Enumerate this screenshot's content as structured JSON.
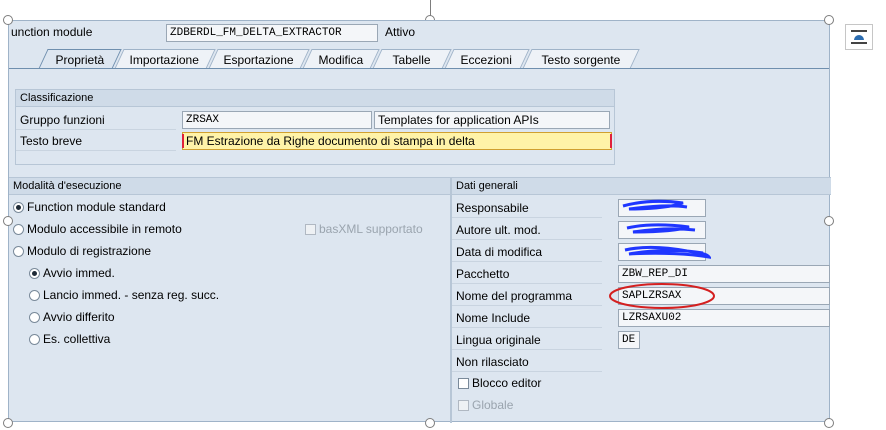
{
  "header": {
    "object_type_label": "unction module",
    "object_name": "ZDBERDL_FM_DELTA_EXTRACTOR",
    "status": "Attivo"
  },
  "tabs": [
    {
      "label": "Proprietà"
    },
    {
      "label": "Importazione"
    },
    {
      "label": "Esportazione"
    },
    {
      "label": "Modifica"
    },
    {
      "label": "Tabelle"
    },
    {
      "label": "Eccezioni"
    },
    {
      "label": "Testo sorgente"
    }
  ],
  "classification": {
    "title": "Classificazione",
    "function_group_label": "Gruppo funzioni",
    "function_group_value": "ZRSAX",
    "function_group_desc": "Templates for application APIs",
    "short_text_label": "Testo breve",
    "short_text_value": "FM Estrazione da Righe documento di stampa in delta"
  },
  "processing_type": {
    "title": "Modalità d'esecuzione",
    "options": [
      {
        "label": "Function module standard",
        "selected": true
      },
      {
        "label": "Modulo accessibile in remoto",
        "selected": false
      },
      {
        "label": "Modulo di registrazione",
        "selected": false
      }
    ],
    "basxml_label": "basXML supportato",
    "update_options": [
      {
        "label": "Avvio immed.",
        "selected": true
      },
      {
        "label": "Lancio immed. - senza reg. succ.",
        "selected": false
      },
      {
        "label": "Avvio differito",
        "selected": false
      },
      {
        "label": "Es. collettiva",
        "selected": false
      }
    ]
  },
  "general_data": {
    "title": "Dati generali",
    "rows": [
      {
        "label": "Responsabile",
        "value": ""
      },
      {
        "label": "Autore ult. mod.",
        "value": ""
      },
      {
        "label": "Data di modifica",
        "value": ""
      },
      {
        "label": "Pacchetto",
        "value": "ZBW_REP_DI"
      },
      {
        "label": "Nome del programma",
        "value": "SAPLZRSAX"
      },
      {
        "label": "Nome Include",
        "value": "LZRSAXU02"
      },
      {
        "label": "Lingua originale",
        "value": "DE"
      }
    ],
    "not_released": "Non rilasciato",
    "editor_lock_label": "Blocco editor",
    "global_label": "Globale"
  },
  "colors": {
    "background": "#dde6f0",
    "group_header": "#cfdbe8",
    "highlight_field": "#fff3a8",
    "scribble": "#1f36ff",
    "annotation": "#d42020"
  }
}
